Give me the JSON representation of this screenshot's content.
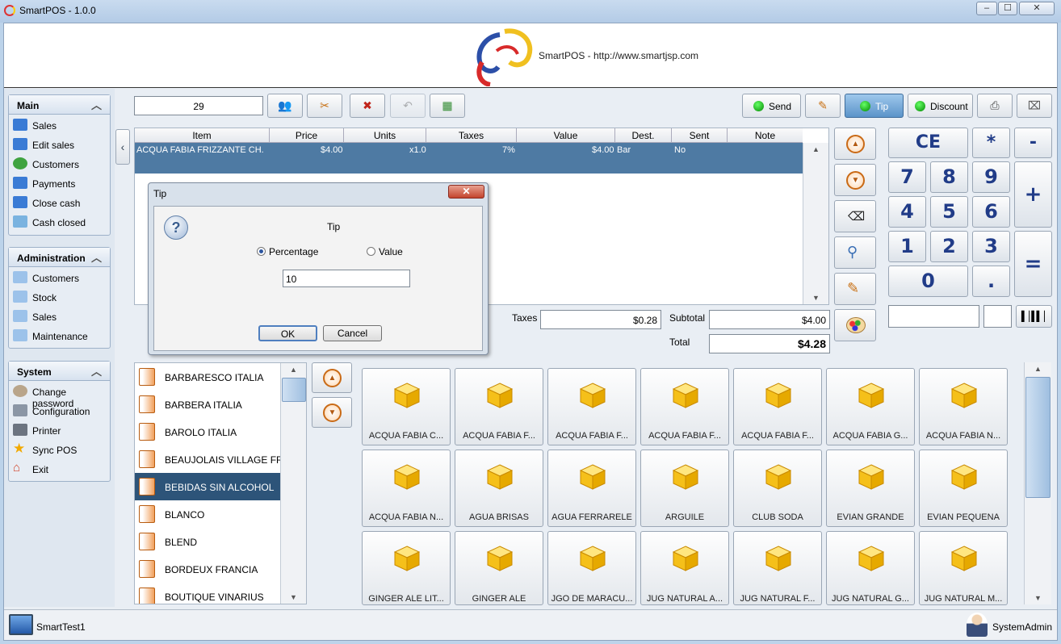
{
  "window": {
    "title": "SmartPOS - 1.0.0"
  },
  "header": {
    "site": "SmartPOS - http://www.smartjsp.com"
  },
  "sidebar": {
    "main": {
      "title": "Main",
      "items": [
        {
          "label": "Sales",
          "icon": "monitor-icon"
        },
        {
          "label": "Edit sales",
          "icon": "monitor-icon"
        },
        {
          "label": "Customers",
          "icon": "users-icon"
        },
        {
          "label": "Payments",
          "icon": "monitor-icon"
        },
        {
          "label": "Close cash",
          "icon": "monitor-icon"
        },
        {
          "label": "Cash closed",
          "icon": "report-icon"
        }
      ]
    },
    "admin": {
      "title": "Administration",
      "items": [
        {
          "label": "Customers",
          "icon": "book-icon"
        },
        {
          "label": "Stock",
          "icon": "book-icon"
        },
        {
          "label": "Sales",
          "icon": "book-icon"
        },
        {
          "label": "Maintenance",
          "icon": "book-icon"
        }
      ]
    },
    "system": {
      "title": "System",
      "items": [
        {
          "label": "Change password",
          "icon": "user-icon"
        },
        {
          "label": "Configuration",
          "icon": "tools-icon"
        },
        {
          "label": "Printer",
          "icon": "printer-icon"
        },
        {
          "label": "Sync POS",
          "icon": "star-icon"
        },
        {
          "label": "Exit",
          "icon": "home-icon"
        }
      ]
    }
  },
  "toolbar": {
    "ticket_number": "29",
    "send": "Send",
    "tip": "Tip",
    "discount": "Discount"
  },
  "ticket": {
    "columns": [
      "Item",
      "Price",
      "Units",
      "Taxes",
      "Value",
      "Dest.",
      "Sent",
      "Note"
    ],
    "rows": [
      {
        "item": "ACQUA FABIA FRIZZANTE CH.",
        "price": "$4.00",
        "units": "x1.0",
        "taxes": "7%",
        "value": "$4.00",
        "dest": "Bar",
        "sent": "No",
        "note": ""
      }
    ]
  },
  "totals": {
    "taxes_label": "Taxes",
    "taxes": "$0.28",
    "subtotal_label": "Subtotal",
    "subtotal": "$4.00",
    "total_label": "Total",
    "total": "$4.28"
  },
  "dialog": {
    "title": "Tip",
    "heading": "Tip",
    "opt_percentage": "Percentage",
    "opt_value": "Value",
    "selected": "Percentage",
    "input": "10",
    "ok": "OK",
    "cancel": "Cancel"
  },
  "keypad": {
    "ce": "CE",
    "mul": "*",
    "minus": "-",
    "plus": "+",
    "eq": "=",
    "dot": ".",
    "digits": [
      "7",
      "8",
      "9",
      "4",
      "5",
      "6",
      "1",
      "2",
      "3",
      "0"
    ]
  },
  "categories": [
    "BARBARESCO ITALIA",
    "BARBERA ITALIA",
    "BAROLO ITALIA",
    "BEAUJOLAIS VILLAGE FRAN",
    "BEBIDAS SIN ALCOHOL",
    "BLANCO",
    "BLEND",
    "BORDEUX FRANCIA",
    "BOUTIQUE  VINARIUS"
  ],
  "selected_category": "BEBIDAS SIN ALCOHOL",
  "products": [
    "ACQUA FABIA C...",
    "ACQUA FABIA F...",
    "ACQUA FABIA F...",
    "ACQUA FABIA F...",
    "ACQUA FABIA F...",
    "ACQUA FABIA G...",
    "ACQUA FABIA N...",
    "ACQUA FABIA N...",
    "AGUA BRISAS",
    "AGUA FERRARELE",
    "ARGUILE",
    "CLUB SODA",
    "EVIAN GRANDE",
    "EVIAN PEQUENA",
    "GINGER  ALE LIT...",
    "GINGER ALE",
    "JGO DE MARACU...",
    "JUG NATURAL  A...",
    "JUG NATURAL F...",
    "JUG NATURAL G...",
    "JUG NATURAL M..."
  ],
  "status": {
    "terminal": "SmartTest1",
    "user": "SystemAdmin"
  }
}
